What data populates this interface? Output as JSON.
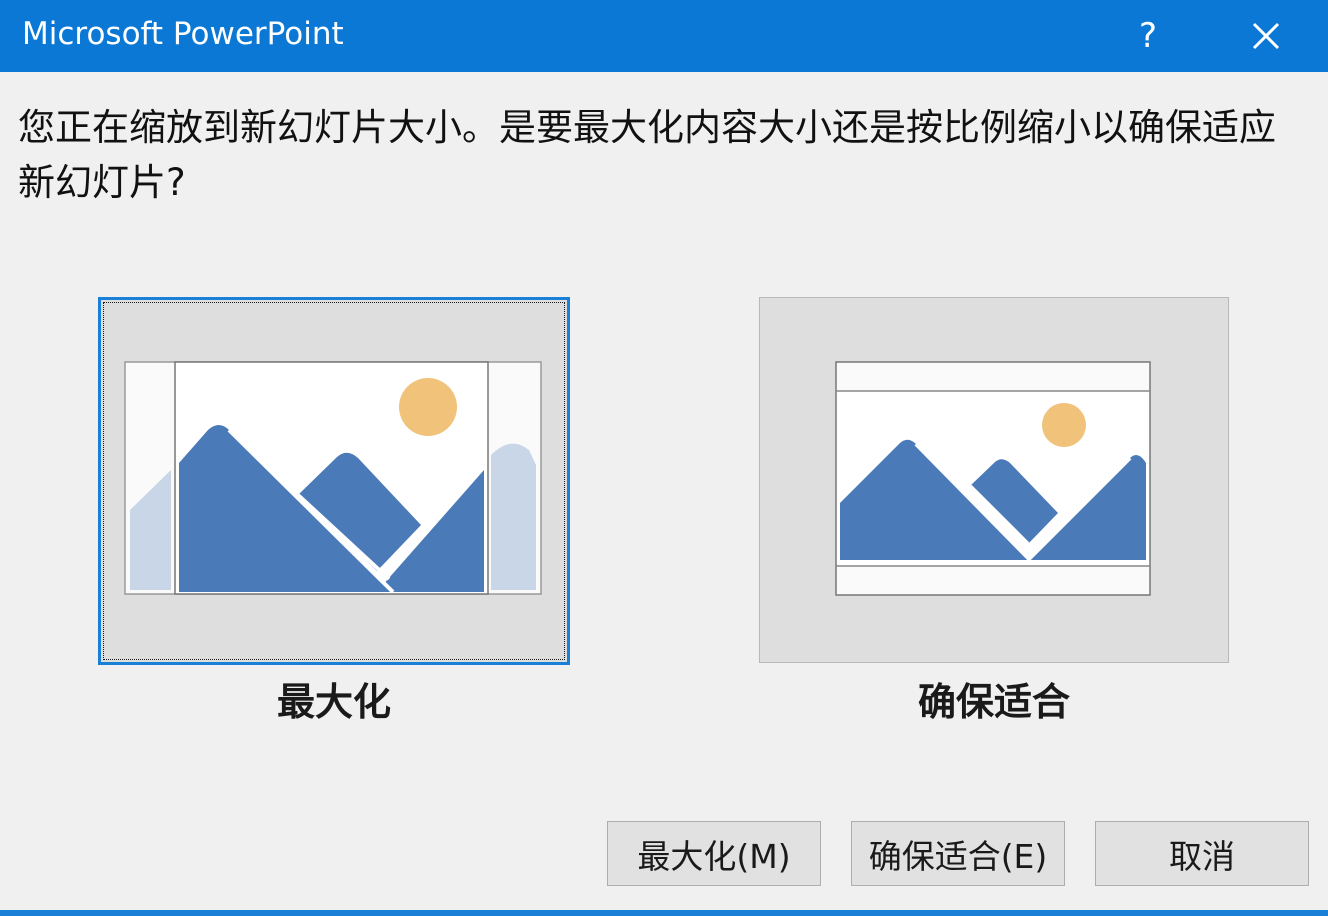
{
  "window": {
    "title": "Microsoft PowerPoint",
    "help_glyph": "?",
    "close_icon": "close-icon"
  },
  "message": "您正在缩放到新幻灯片大小。是要最大化内容大小还是按比例缩小以确保适应新幻灯片?",
  "options": {
    "maximize": {
      "label": "最大化",
      "selected": true
    },
    "ensure_fit": {
      "label": "确保适合",
      "selected": false
    }
  },
  "buttons": {
    "maximize": "最大化(M)",
    "ensure_fit": "确保适合(E)",
    "cancel": "取消"
  },
  "colors": {
    "titlebar": "#0a78d4",
    "selection_border": "#1a7fd6",
    "mountain": "#4a7ab8",
    "mountain_faded": "#c8d6e8",
    "sun": "#f0c27a"
  }
}
